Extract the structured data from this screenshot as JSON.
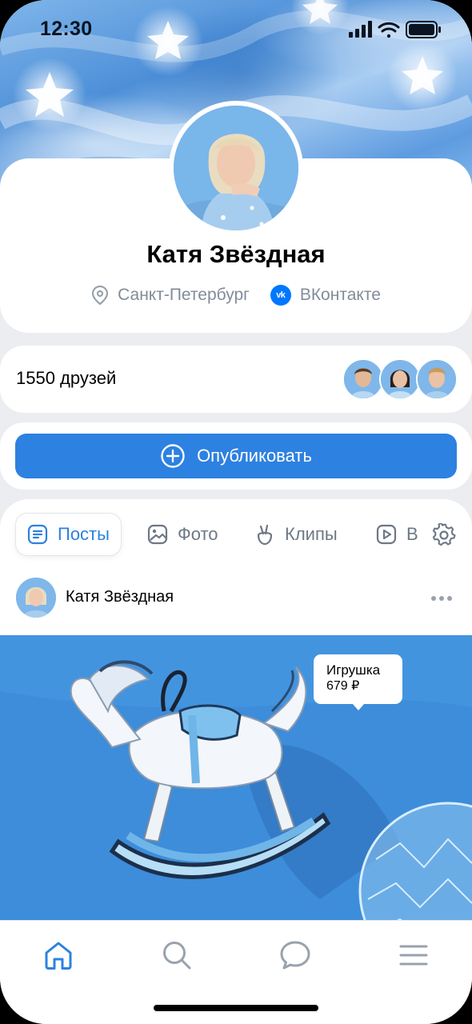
{
  "status_bar": {
    "time": "12:30"
  },
  "profile": {
    "name": "Катя Звёздная",
    "city": "Санкт-Петербург",
    "network": "ВКонтакте"
  },
  "friends": {
    "count_label": "1550 друзей"
  },
  "publish": {
    "label": "Опубликовать"
  },
  "tabs": [
    {
      "label": "Посты",
      "icon": "posts-icon",
      "active": true
    },
    {
      "label": "Фото",
      "icon": "photo-icon"
    },
    {
      "label": "Клипы",
      "icon": "clips-icon"
    },
    {
      "label": "В",
      "icon": "video-icon"
    }
  ],
  "post": {
    "author": "Катя Звёздная",
    "tag": {
      "name": "Игрушка",
      "price": "679 ₽"
    }
  },
  "bottom_nav": [
    "home-icon",
    "search-icon",
    "messages-icon",
    "menu-icon"
  ],
  "colors": {
    "accent": "#2d81e0",
    "vk_blue": "#0077ff",
    "secondary_text": "#818c99"
  }
}
